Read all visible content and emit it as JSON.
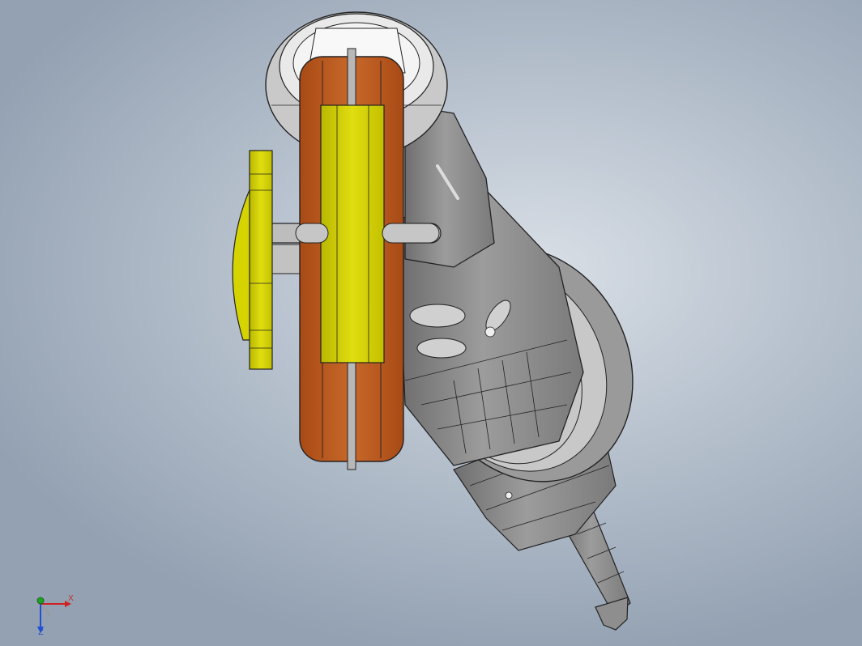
{
  "colors": {
    "background_center": "#d9dfe6",
    "background_edge": "#93a1b2",
    "body_grey": "#8a8a8a",
    "body_light": "#c4c4c4",
    "disc_orange": "#c05a1f",
    "disc_orange_light": "#d97a3a",
    "gear_yellow": "#d7d600",
    "gear_yellow_dark": "#b3b000",
    "outline": "#222222",
    "triad_x": "#d02020",
    "triad_y": "#20a020",
    "triad_z": "#2050d0"
  },
  "triad": {
    "x_label": "X",
    "z_label": "Z"
  }
}
